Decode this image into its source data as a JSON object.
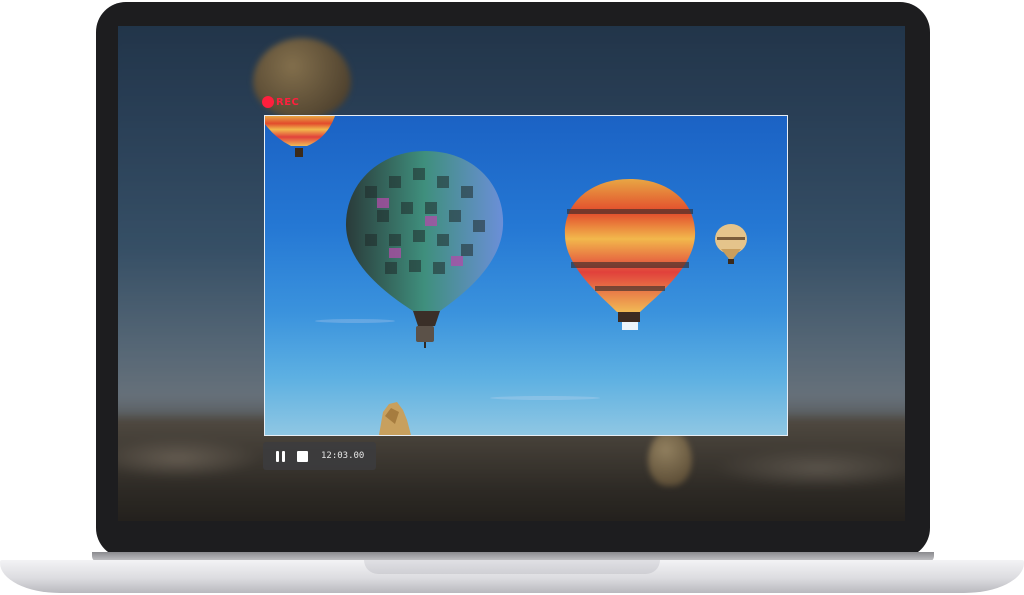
{
  "recorder": {
    "rec_label": "REC",
    "timer": "12:03.00",
    "controls": {
      "pause_icon": "pause-icon",
      "stop_icon": "stop-icon"
    }
  },
  "colors": {
    "rec_red": "#ff1f3d",
    "bezel": "#1d1d1f",
    "region_border": "#e8eef5"
  }
}
